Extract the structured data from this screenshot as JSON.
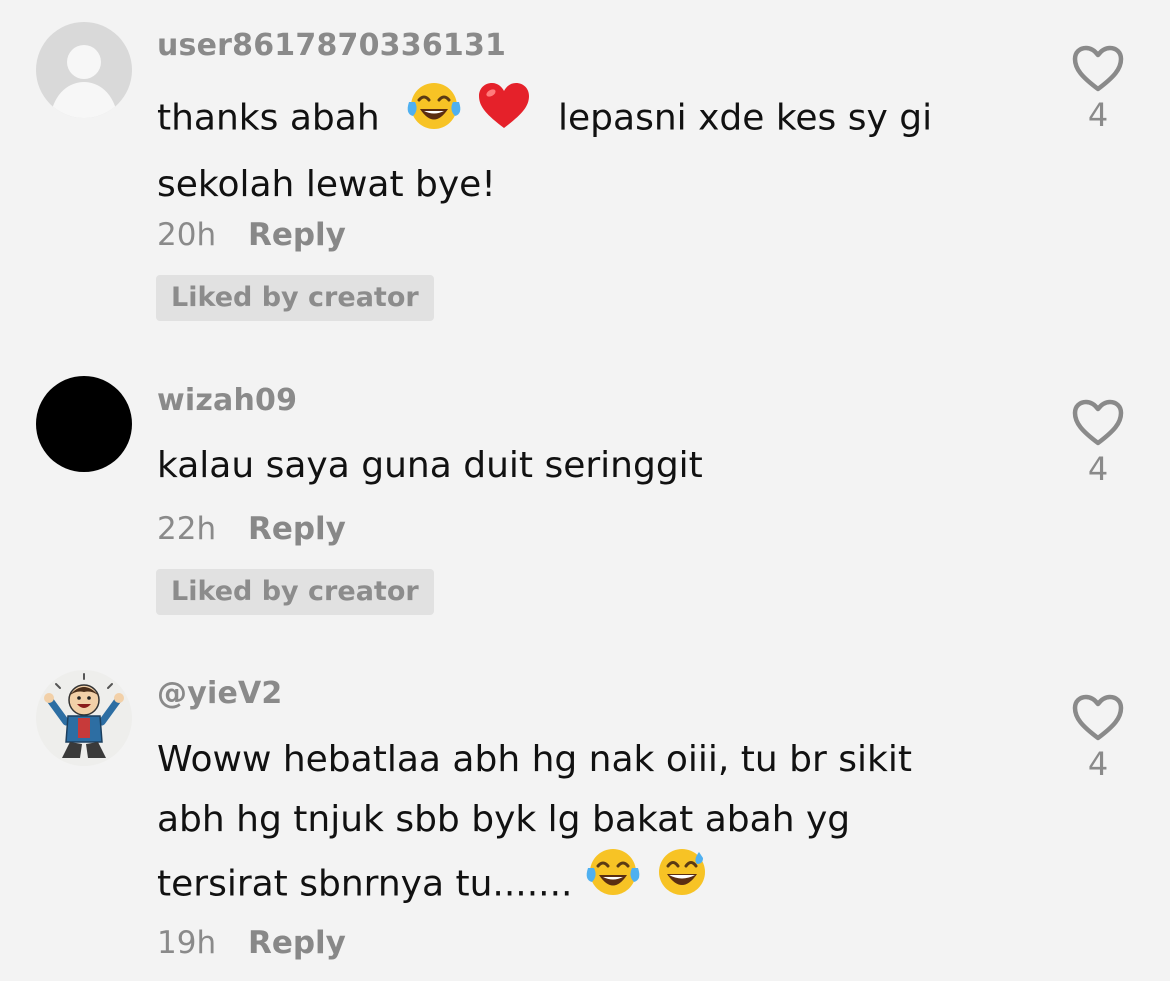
{
  "comments": [
    {
      "username": "user8617870336131",
      "text_lines": [
        "thanks abah",
        "lepasni xde kes sy gi",
        "sekolah lewat bye!"
      ],
      "emojis": [
        "tears-of-joy-emoji",
        "red-heart-emoji"
      ],
      "time": "20h",
      "reply_label": "Reply",
      "liked_by_creator": "Liked by creator",
      "likes": "4"
    },
    {
      "username": "wizah09",
      "text_lines": [
        "kalau saya guna duit seringgit"
      ],
      "time": "22h",
      "reply_label": "Reply",
      "liked_by_creator": "Liked by creator",
      "likes": "4"
    },
    {
      "username": "@yieV2",
      "text_lines": [
        "Woww hebatlaa abh hg nak oiii, tu br sikit",
        "abh hg tnjuk sbb byk lg bakat abah yg",
        "tersirat sbnrnya tu......."
      ],
      "emojis": [
        "tears-of-joy-emoji",
        "grinning-sweat-emoji"
      ],
      "time": "19h",
      "reply_label": "Reply",
      "likes": "4"
    }
  ],
  "colors": {
    "background": "#f3f3f3",
    "muted_text": "#8a8a8a",
    "body_text": "#111111",
    "badge_bg": "#e1e1e1"
  }
}
